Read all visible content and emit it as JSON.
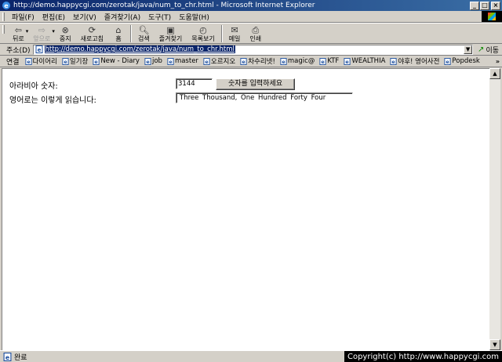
{
  "window": {
    "title": "http://demo.happycgi.com/zerotak/java/num_to_chr.html - Microsoft Internet Explorer",
    "buttons": {
      "minimize": "_",
      "maximize": "□",
      "close": "×"
    }
  },
  "menu": [
    "파일(F)",
    "편집(E)",
    "보기(V)",
    "즐겨찾기(A)",
    "도구(T)",
    "도움말(H)"
  ],
  "toolbar": {
    "back": "뒤로",
    "forward": "앞으로",
    "stop": "중지",
    "refresh": "새로고침",
    "home": "홈",
    "search": "검색",
    "favorites": "즐겨찾기",
    "history": "목록보기",
    "mail": "메일",
    "print": "인쇄"
  },
  "address": {
    "label": "주소(D)",
    "url": "http://demo.happycgi.com/zerotak/java/num_to_chr.html",
    "go_label": "이동"
  },
  "links": {
    "label": "연결",
    "items": [
      "다이어리",
      "일기장",
      "New - Diary",
      "job",
      "master",
      "오르지오",
      "차수리넷!",
      "magic@",
      "KTF",
      "WEALTHIA",
      "야후! 영어사전",
      "Popdesk"
    ],
    "more": "»"
  },
  "page": {
    "arabic_label": "아라비아 숫자:",
    "number_value": "3144",
    "convert_button": "숫자를 입력하세요",
    "english_label": "영어로는 이렇게 읽습니다:",
    "words_value": "Three Thousand, One Hundred Forty Four"
  },
  "status": {
    "text": "완료",
    "copyright": "Copyright(c) http://www.happycgi.com"
  },
  "colors": {
    "titlebar": "#0a246a",
    "chrome": "#d4d0c8",
    "selection": "#0a246a"
  }
}
